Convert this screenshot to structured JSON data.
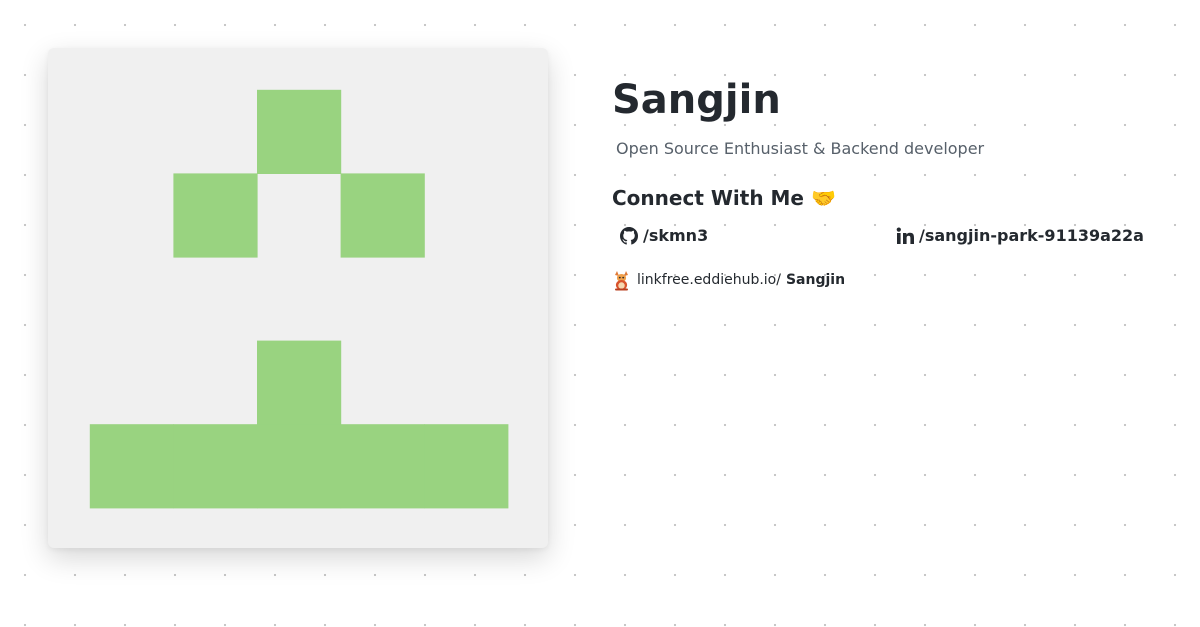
{
  "profile": {
    "name": "Sangjin",
    "bio": "Open Source Enthusiast & Backend developer"
  },
  "connect": {
    "title": "Connect With Me 🤝",
    "github": {
      "icon": "github-icon",
      "handle": "/skmn3"
    },
    "linkedin": {
      "icon": "linkedin-icon",
      "handle": "/sangjin-park-91139a22a"
    }
  },
  "linkfree": {
    "icon": "linkfree-mascot-icon",
    "domain": "linkfree.eddiehub.io/",
    "username": "Sangjin"
  },
  "avatar": {
    "description_icon": "identicon-avatar",
    "color": "#99d380",
    "background": "#f0f0f0"
  }
}
